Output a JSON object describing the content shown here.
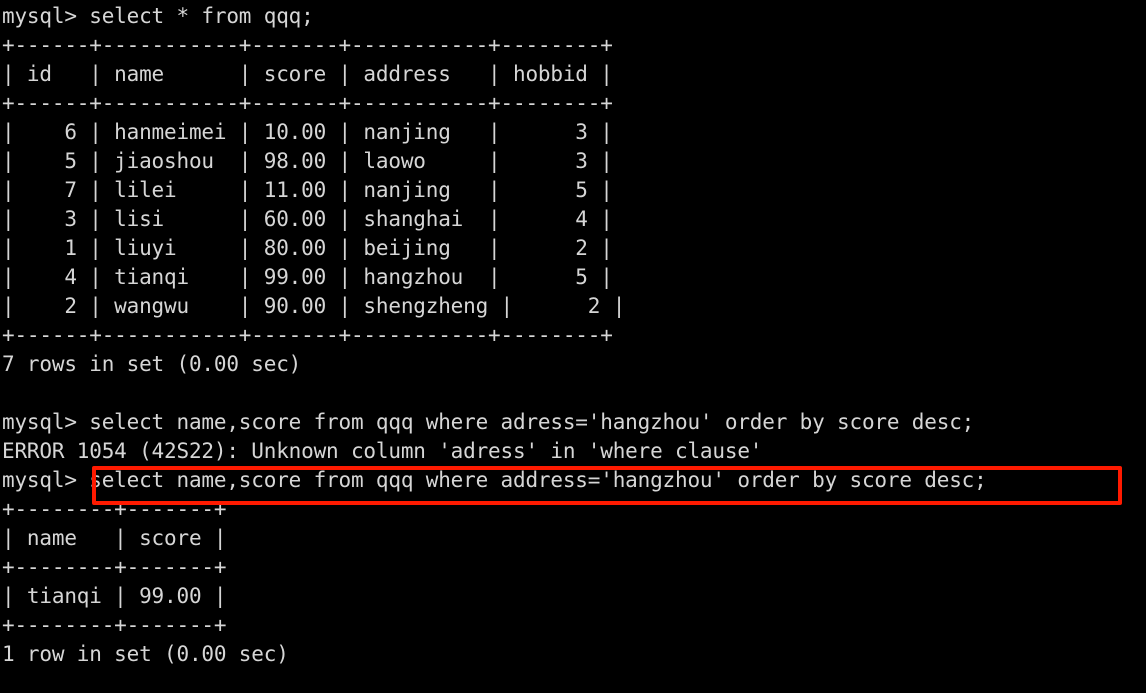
{
  "terminal": {
    "prompt": "mysql>",
    "foreground_color": "#d6d6d6",
    "background_color": "#000000",
    "highlight_color": "#ff1a00",
    "lines": [
      "mysql> select * from qqq;",
      "+------+-----------+-------+-----------+--------+",
      "| id   | name      | score | address   | hobbid |",
      "+------+-----------+-------+-----------+--------+",
      "|    6 | hanmeimei | 10.00 | nanjing   |      3 |",
      "|    5 | jiaoshou  | 98.00 | laowo     |      3 |",
      "|    7 | lilei     | 11.00 | nanjing   |      5 |",
      "|    3 | lisi      | 60.00 | shanghai  |      4 |",
      "|    1 | liuyi     | 80.00 | beijing   |      2 |",
      "|    4 | tianqi    | 99.00 | hangzhou  |      5 |",
      "|    2 | wangwu    | 90.00 | shengzheng |      2 |",
      "+------+-----------+-------+-----------+--------+",
      "7 rows in set (0.00 sec)",
      "",
      "mysql> select name,score from qqq where adress='hangzhou' order by score desc;",
      "ERROR 1054 (42S22): Unknown column 'adress' in 'where clause'",
      "mysql> select name,score from qqq where address='hangzhou' order by score desc;",
      "+--------+-------+",
      "| name   | score |",
      "+--------+-------+",
      "| tianqi | 99.00 |",
      "+--------+-------+",
      "1 row in set (0.00 sec)"
    ],
    "commands": {
      "select_all": "select * from qqq;",
      "failed_query": "select name,score from qqq where adress='hangzhou' order by score desc;",
      "corrected_query": "select name,score from qqq where address='hangzhou' order by score desc;"
    },
    "error": {
      "code": "1054",
      "sqlstate": "42S22",
      "message": "ERROR 1054 (42S22): Unknown column 'adress' in 'where clause'"
    },
    "result_1": {
      "columns": [
        "id",
        "name",
        "score",
        "address",
        "hobbid"
      ],
      "rows": [
        [
          "6",
          "hanmeimei",
          "10.00",
          "nanjing",
          "3"
        ],
        [
          "5",
          "jiaoshou",
          "98.00",
          "laowo",
          "3"
        ],
        [
          "7",
          "lilei",
          "11.00",
          "nanjing",
          "5"
        ],
        [
          "3",
          "lisi",
          "60.00",
          "shanghai",
          "4"
        ],
        [
          "1",
          "liuyi",
          "80.00",
          "beijing",
          "2"
        ],
        [
          "4",
          "tianqi",
          "99.00",
          "hangzhou",
          "5"
        ],
        [
          "2",
          "wangwu",
          "90.00",
          "shengzheng",
          "2"
        ]
      ],
      "status": "7 rows in set (0.00 sec)"
    },
    "result_2": {
      "columns": [
        "name",
        "score"
      ],
      "rows": [
        [
          "tianqi",
          "99.00"
        ]
      ],
      "status": "1 row in set (0.00 sec)"
    }
  }
}
